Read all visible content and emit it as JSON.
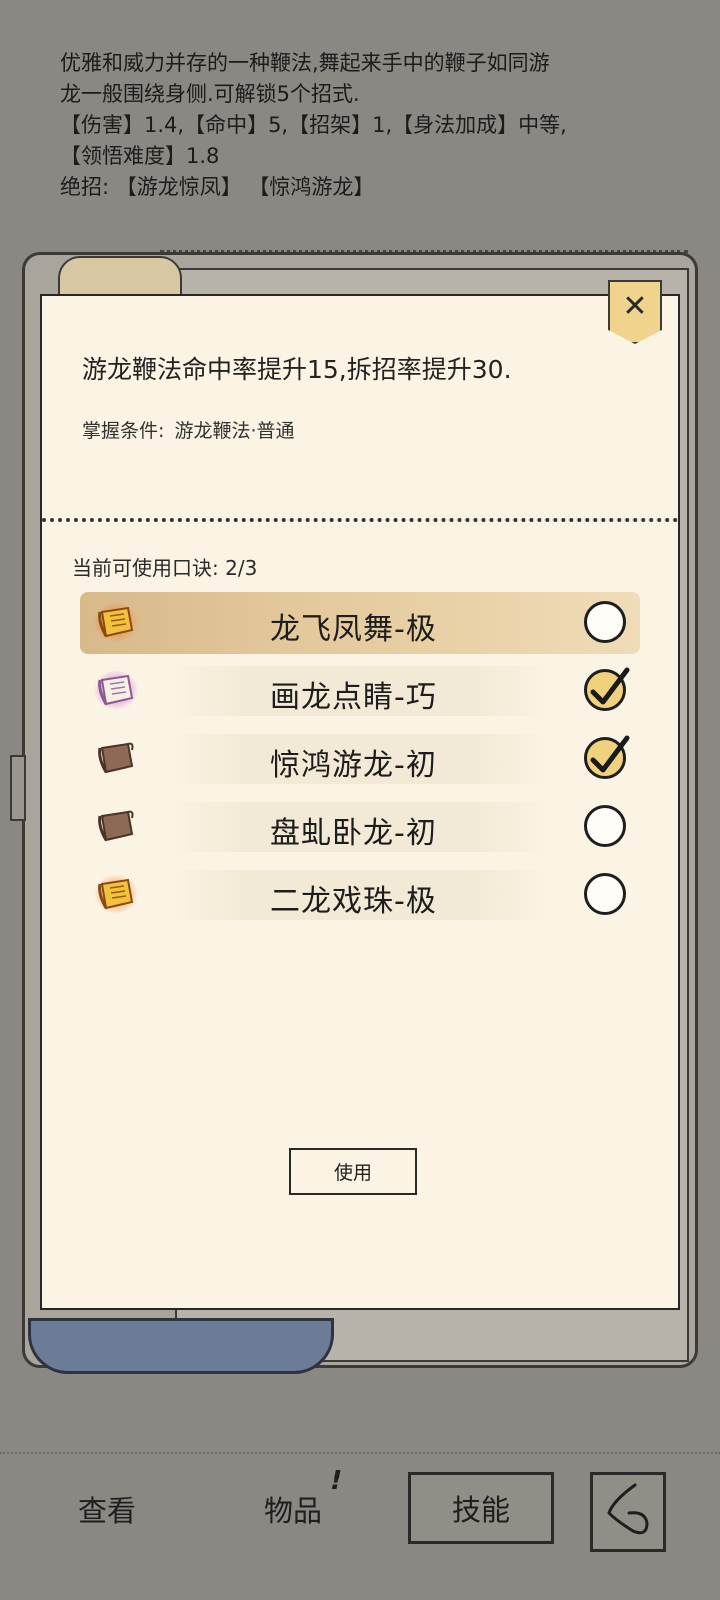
{
  "description": {
    "lines": [
      "优雅和威力并存的一种鞭法,舞起来手中的鞭子如同游",
      "龙一般围绕身侧.可解锁5个招式.",
      "【伤害】1.4,【命中】5,【招架】1,【身法加成】中等,",
      "【领悟难度】1.8",
      "绝招: 【游龙惊凤】 【惊鸿游龙】"
    ]
  },
  "dialog": {
    "close_label": "✕",
    "effect_text": "游龙鞭法命中率提升15,拆招率提升30.",
    "mastery_label": "掌握条件:",
    "mastery_value": "游龙鞭法·普通",
    "available_label": "当前可使用口诀:",
    "available_count": "2/3",
    "use_button": "使用",
    "skills": [
      {
        "name": "龙飞凤舞-极",
        "icon": "gold-scroll-icon",
        "checked": false,
        "selected": true
      },
      {
        "name": "画龙点睛-巧",
        "icon": "purple-scroll-icon",
        "checked": true,
        "selected": false
      },
      {
        "name": "惊鸿游龙-初",
        "icon": "brown-scroll-icon",
        "checked": true,
        "selected": false
      },
      {
        "name": "盘虬卧龙-初",
        "icon": "brown-scroll-icon",
        "checked": false,
        "selected": false
      },
      {
        "name": "二龙戏珠-极",
        "icon": "gold-scroll-icon",
        "checked": false,
        "selected": false
      }
    ]
  },
  "bottom_nav": {
    "view": "查看",
    "items": "物品",
    "items_badge": "!",
    "skills": "技能",
    "back_icon": "back-arrow-icon"
  },
  "colors": {
    "panel_bg": "#fbf4e4",
    "page_bg": "#8b8883",
    "check_fill": "#f1d27c"
  }
}
